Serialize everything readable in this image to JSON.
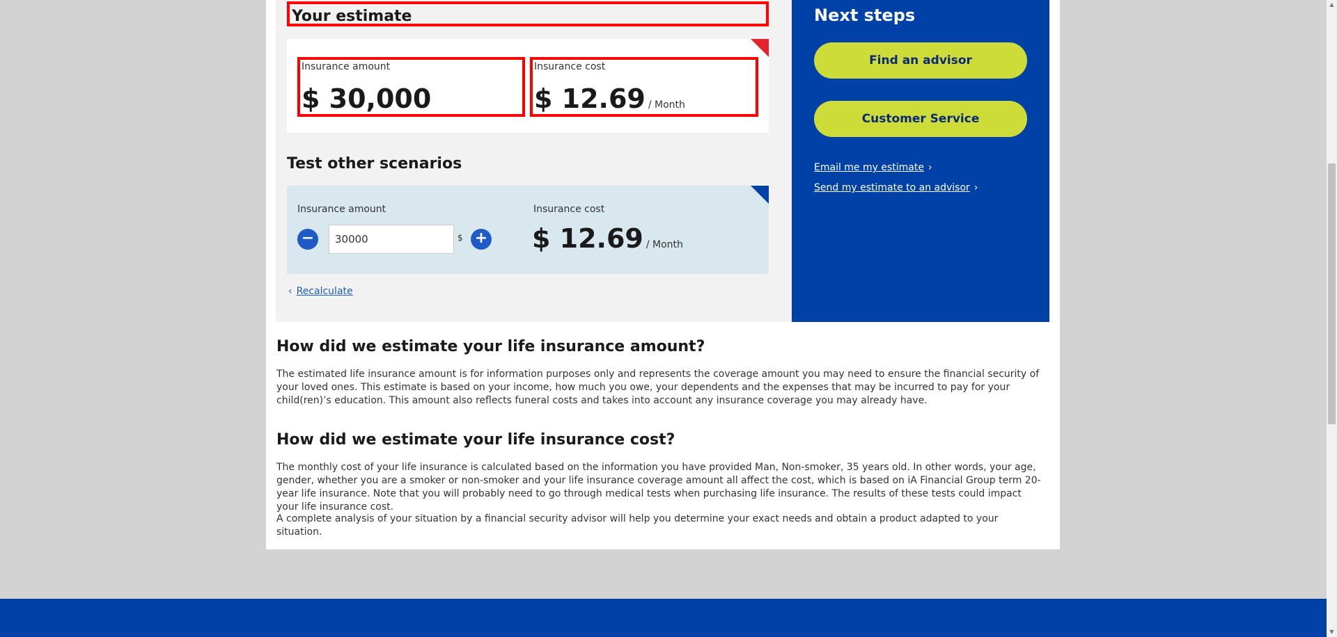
{
  "estimate": {
    "title": "Your estimate",
    "amount_label": "Insurance amount",
    "amount_value": "$ 30,000",
    "cost_label": "Insurance cost",
    "cost_value": "$ 12.69",
    "cost_unit": "/ Month"
  },
  "scenarios": {
    "title": "Test other scenarios",
    "amount_label": "Insurance amount",
    "minus": "−",
    "plus": "+",
    "amount_input": "30000",
    "currency": "$",
    "cost_label": "Insurance cost",
    "cost_value": "$ 12.69",
    "cost_unit": "/ Month",
    "recalculate": "Recalculate",
    "back_chevron": "‹"
  },
  "next_steps": {
    "title": "Next steps",
    "find_advisor": "Find an advisor",
    "customer_service": "Customer Service",
    "email_link": "Email me my estimate",
    "send_link": "Send my estimate to an advisor",
    "chevron": "›"
  },
  "explanations": {
    "amount_heading": "How did we estimate your life insurance amount?",
    "amount_text": "The estimated life insurance amount is for information purposes only and represents the coverage amount you may need to ensure the financial security of your loved ones. This estimate is based on your income, how much you owe, your dependents and the expenses that may be incurred to pay for your child(ren)’s education. This amount also reflects funeral costs and takes into account any insurance coverage you may already have.",
    "cost_heading": "How did we estimate your life insurance cost?",
    "cost_text": "The monthly cost of your life insurance is calculated based on the information you have provided Man, Non-smoker, 35 years old. In other words, your age, gender, whether you are a smoker or non-smoker and your life insurance coverage amount all affect the cost, which is based on iA Financial Group term 20-year life insurance. Note that you will probably need to go through medical tests when purchasing life insurance. The results of these tests could impact your life insurance cost.",
    "analysis_text": "A complete analysis of your situation by a financial security advisor will help you determine your exact needs and obtain a product adapted to your situation."
  },
  "colors": {
    "brand_blue": "#0041a8",
    "accent_lime": "#cddc39",
    "highlight_red": "#ff0000"
  }
}
